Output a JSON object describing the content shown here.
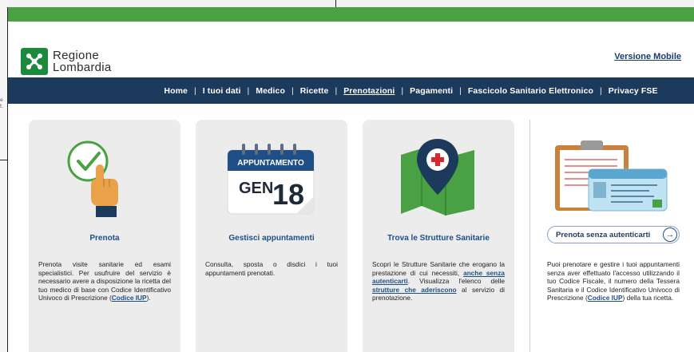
{
  "background": {
    "side_text": "e\nt."
  },
  "header": {
    "logo_line1": "Regione",
    "logo_line2": "Lombardia",
    "mobile_link": "Versione Mobile"
  },
  "nav": {
    "items": [
      {
        "label": "Home",
        "active": false
      },
      {
        "label": "I tuoi dati",
        "active": false
      },
      {
        "label": "Medico",
        "active": false
      },
      {
        "label": "Ricette",
        "active": false
      },
      {
        "label": "Prenotazioni",
        "active": true
      },
      {
        "label": "Pagamenti",
        "active": false
      },
      {
        "label": "Fascicolo Sanitario Elettronico",
        "active": false
      },
      {
        "label": "Privacy FSE",
        "active": false
      }
    ]
  },
  "cards": {
    "prenota": {
      "title": "Prenota",
      "text_1": "Prenota visite sanitarie ed esami specialistici. Per usufruire del servizio è necessario avere a disposizione la ricetta del tuo medico di base con Codice Identificativo Univoco di Prescrizione (",
      "link": "Codice IUP",
      "text_2": ")."
    },
    "appuntamenti": {
      "title": "Gestisci appuntamenti",
      "text": "Consulta, sposta o disdici i tuoi appuntamenti prenotati.",
      "calendar_header": "APPUNTAMENTO",
      "calendar_month": "GEN",
      "calendar_day": "18"
    },
    "strutture": {
      "title": "Trova le Strutture Sanitarie",
      "text_1": "Scopri le Strutture Sanitarie che erogano la prestazione di cui necessiti, ",
      "link_1": "anche senza autenticarti",
      "text_2": ". Visualizza l'elenco delle ",
      "link_2": "strutture che aderiscono",
      "text_3": " al servizio di prenotazione."
    },
    "senza_auth": {
      "button": "Prenota senza autenticarti",
      "text_1": "Puoi prenotare e gestire i tuoi appuntamenti senza aver effettuato l'accesso utilizzando il tuo Codice Fiscale, il numero della Tessera Sanitaria e il Codice Identificativo Univoco di Prescrizione (",
      "link": "Codice IUP",
      "text_2": ") della tua ricetta."
    }
  },
  "colors": {
    "top_band": "#4aa143",
    "navbar": "#1b3a5c",
    "logo": "#1b8a3c",
    "link": "#1f4f86",
    "card_bg": "#ececec"
  }
}
